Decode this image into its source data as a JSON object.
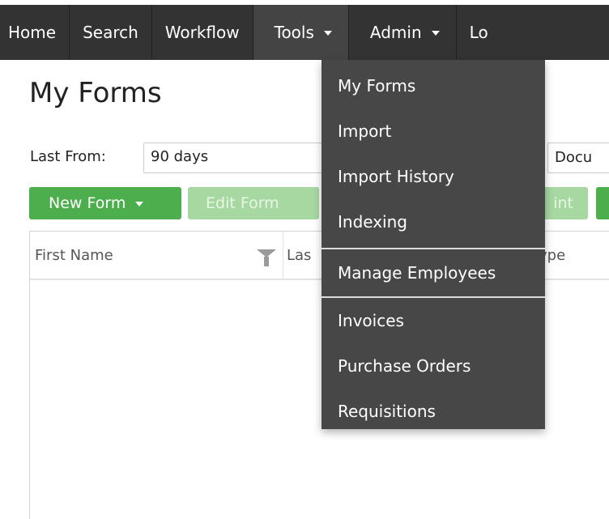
{
  "navbar": {
    "items": [
      {
        "label": "Home",
        "has_caret": false
      },
      {
        "label": "Search",
        "has_caret": false
      },
      {
        "label": "Workflow",
        "has_caret": false
      },
      {
        "label": "Tools",
        "has_caret": true,
        "active": true
      },
      {
        "label": "Admin",
        "has_caret": true
      },
      {
        "label": "Lo",
        "has_caret": false
      }
    ]
  },
  "page": {
    "title": "My Forms"
  },
  "filters": {
    "last_from_label": "Last From:",
    "last_from_value": "90 days",
    "doc_label_partial": "Docu"
  },
  "toolbar": {
    "new_form_label": "New Form",
    "edit_form_label": "Edit Form",
    "print_label_partial": "int"
  },
  "grid": {
    "columns": [
      {
        "label": "First Name"
      },
      {
        "label": "Las"
      },
      {
        "label": "ype"
      }
    ]
  },
  "tools_menu": {
    "items": [
      {
        "label": "My Forms"
      },
      {
        "label": "Import"
      },
      {
        "label": "Import History"
      },
      {
        "label": "Indexing"
      },
      {
        "label": "Manage Employees"
      },
      {
        "label": "Invoices"
      },
      {
        "label": "Purchase Orders"
      },
      {
        "label": "Requisitions"
      }
    ]
  },
  "colors": {
    "navbar_bg": "#333333",
    "dropdown_bg": "#474747",
    "primary_green": "#4cae4c",
    "disabled_green": "#a7d8a2"
  }
}
